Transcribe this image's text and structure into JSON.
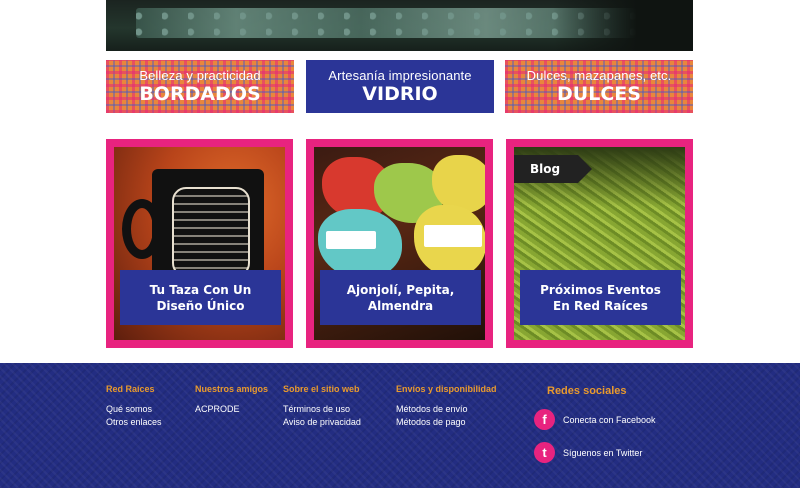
{
  "categories": [
    {
      "subtitle": "Belleza y practicidad",
      "title": "BORDADOS"
    },
    {
      "subtitle": "Artesanía impresionante",
      "title": "VIDRIO"
    },
    {
      "subtitle": "Dulces, mazapanes, etc.",
      "title": "DULCES"
    }
  ],
  "cards": [
    {
      "caption": "Tu Taza Con Un Diseño Único"
    },
    {
      "caption": "Ajonjolí, Pepita, Almendra"
    },
    {
      "caption": "Próximos Eventos En Red Raíces",
      "tag": "Blog"
    }
  ],
  "footer": {
    "columns": [
      {
        "heading": "Red Raíces",
        "links": [
          "Qué somos",
          "Otros enlaces"
        ]
      },
      {
        "heading": "Nuestros amigos",
        "links": [
          "ACPRODE"
        ]
      },
      {
        "heading": "Sobre el sitio web",
        "links": [
          "Términos de uso",
          "Aviso de privacidad"
        ]
      },
      {
        "heading": "Envíos y disponibilidad",
        "links": [
          "Métodos de envío",
          "Métodos de pago"
        ]
      }
    ],
    "social": {
      "heading": "Redes sociales",
      "items": [
        {
          "icon": "facebook-icon",
          "glyph": "f",
          "label": "Conecta con Facebook"
        },
        {
          "icon": "twitter-icon",
          "glyph": "t",
          "label": "Síguenos en Twitter"
        }
      ]
    }
  },
  "colors": {
    "brand_blue": "#2b3597",
    "brand_pink": "#e8237f",
    "accent_orange": "#e99a2d"
  }
}
